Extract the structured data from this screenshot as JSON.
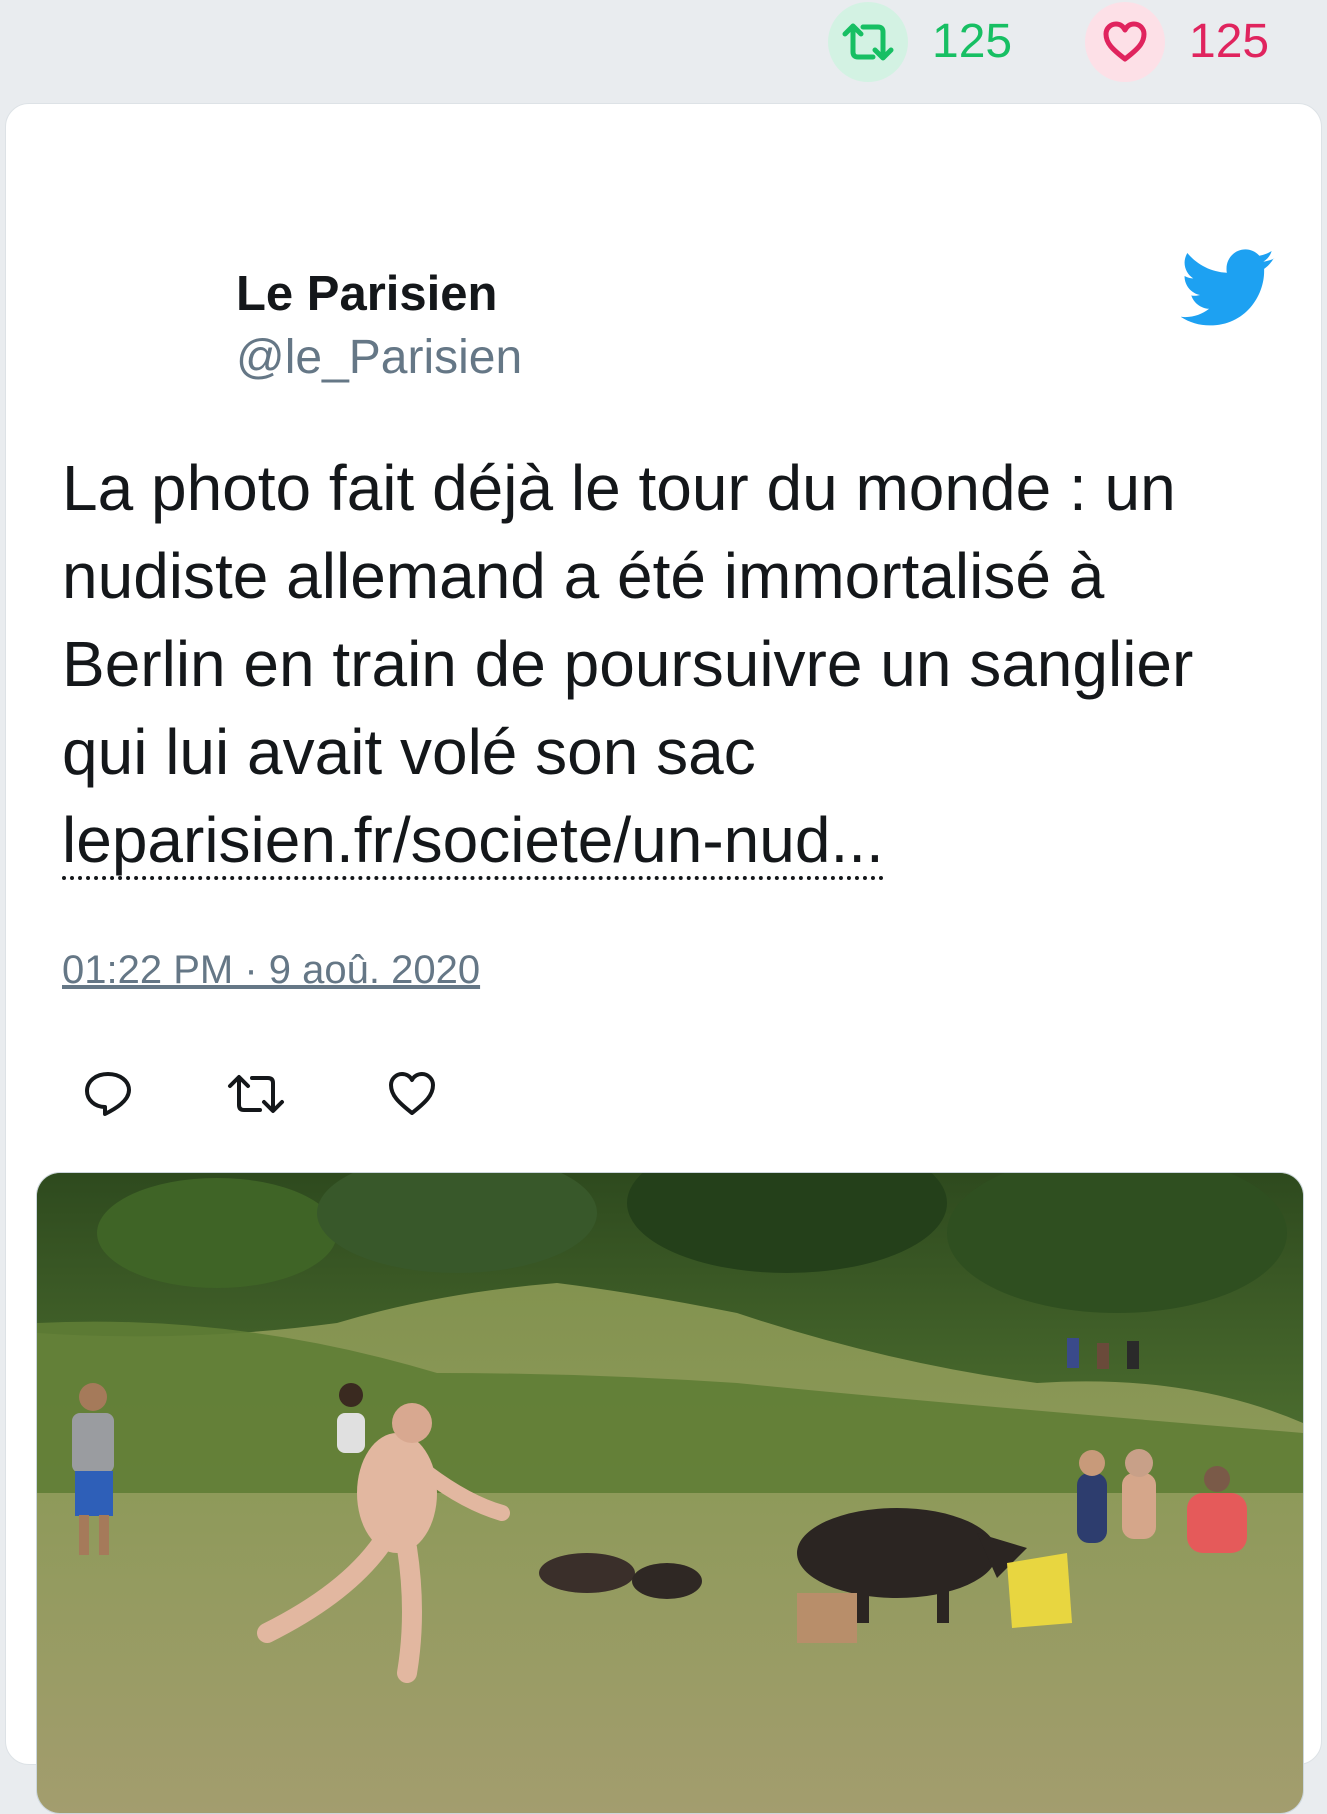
{
  "header": {
    "retweet_count": "125",
    "like_count": "125"
  },
  "tweet": {
    "author_name": "Le Parisien",
    "author_handle": "@le_Parisien",
    "text": "La photo fait déjà le tour du monde : un nudiste allemand a été immortalisé à Berlin en train de poursuivre un sanglier qui lui avait volé son sac",
    "link_text": "leparisien.fr/societe/un-nud...",
    "timestamp": "01:22 PM · 9 aoû. 2020"
  },
  "icons": {
    "retweet": "retweet-icon",
    "like": "heart-icon",
    "reply": "reply-icon",
    "brand": "twitter-bird-icon"
  },
  "colors": {
    "retweet_green": "#17bf63",
    "like_red": "#e0245e",
    "twitter_blue": "#1da1f2",
    "secondary_text": "#657786"
  }
}
